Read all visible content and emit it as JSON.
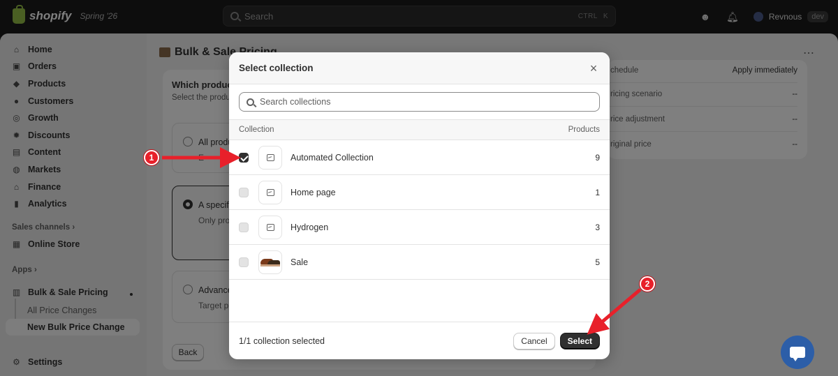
{
  "topbar": {
    "brand": "shopify",
    "season": "Spring '26",
    "search_placeholder": "Search",
    "shortcut_ctrl": "CTRL",
    "shortcut_k": "K",
    "user_name": "Revnous",
    "user_badge": "dev"
  },
  "sidebar": {
    "items": [
      {
        "label": "Home",
        "icon": "home-icon"
      },
      {
        "label": "Orders",
        "icon": "orders-icon"
      },
      {
        "label": "Products",
        "icon": "tag-icon"
      },
      {
        "label": "Customers",
        "icon": "person-icon"
      },
      {
        "label": "Growth",
        "icon": "growth-icon"
      },
      {
        "label": "Discounts",
        "icon": "discount-icon"
      },
      {
        "label": "Content",
        "icon": "content-icon"
      },
      {
        "label": "Markets",
        "icon": "globe-icon"
      },
      {
        "label": "Finance",
        "icon": "bank-icon"
      },
      {
        "label": "Analytics",
        "icon": "chart-icon"
      }
    ],
    "sales_channels_label": "Sales channels",
    "online_store": "Online Store",
    "apps_label": "Apps",
    "app_name": "Bulk & Sale Pricing",
    "sub_all": "All Price Changes",
    "sub_new": "New Bulk Price Change",
    "settings": "Settings"
  },
  "page": {
    "title": "Bulk & Sale Pricing",
    "card_heading": "Which produc",
    "card_sub": "Select the produ",
    "opt_all": "All produ",
    "opt_all_sub": "E",
    "opt_specific": "A specif",
    "opt_specific_sub": "Only pro",
    "opt_advanced": "Advance",
    "opt_advanced_sub": "Target p",
    "back": "Back",
    "summary": [
      {
        "label": "chedule",
        "value": "Apply immediately"
      },
      {
        "label": "ricing scenario",
        "value": "--"
      },
      {
        "label": "rice adjustment",
        "value": "--"
      },
      {
        "label": "riginal price",
        "value": "--"
      }
    ]
  },
  "modal": {
    "title": "Select collection",
    "search_placeholder": "Search collections",
    "col_collection": "Collection",
    "col_products": "Products",
    "rows": [
      {
        "name": "Automated Collection",
        "count": "9",
        "checked": true
      },
      {
        "name": "Home page",
        "count": "1",
        "checked": false
      },
      {
        "name": "Hydrogen",
        "count": "3",
        "checked": false
      },
      {
        "name": "Sale",
        "count": "5",
        "checked": false
      }
    ],
    "footer_status": "1/1 collection selected",
    "cancel": "Cancel",
    "select": "Select"
  },
  "annotations": {
    "marker1": "1",
    "marker2": "2",
    "color": "#e8202a"
  }
}
